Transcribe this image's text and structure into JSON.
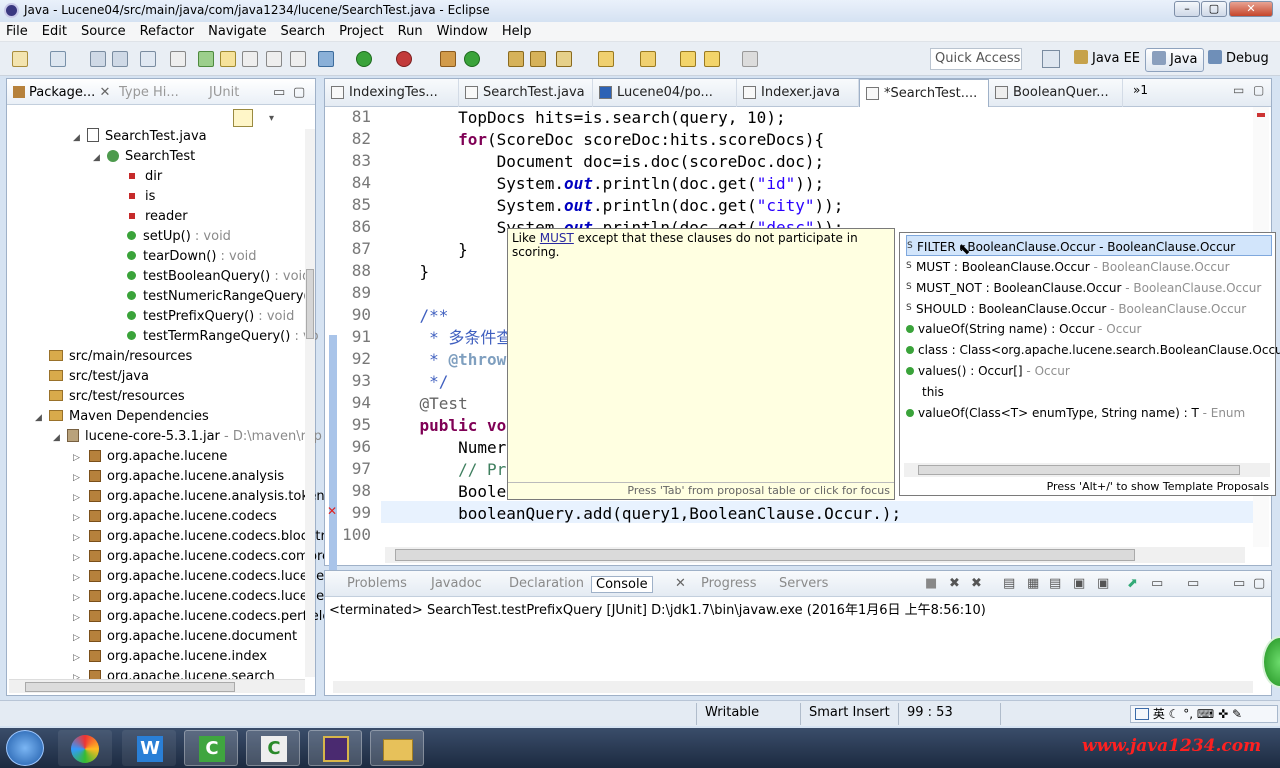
{
  "window": {
    "title": "Java - Lucene04/src/main/java/com/java1234/lucene/SearchTest.java - Eclipse",
    "min": "–",
    "max": "▢",
    "close": "✕"
  },
  "menu": [
    "File",
    "Edit",
    "Source",
    "Refactor",
    "Navigate",
    "Search",
    "Project",
    "Run",
    "Window",
    "Help"
  ],
  "quick_access": "Quick Access",
  "perspectives": [
    {
      "label": "Java EE",
      "active": false
    },
    {
      "label": "Java",
      "active": true
    },
    {
      "label": "Debug",
      "active": false
    }
  ],
  "left_tabs": [
    "Package...",
    "Type Hi...",
    "JUnit"
  ],
  "tree": [
    {
      "text": "SearchTest.java",
      "kind": "jfile"
    },
    {
      "text": "SearchTest",
      "kind": "class"
    },
    {
      "text": "dir",
      "kind": "field"
    },
    {
      "text": "is",
      "kind": "field"
    },
    {
      "text": "reader",
      "kind": "field"
    },
    {
      "text": "setUp()",
      "type": " : void",
      "kind": "method"
    },
    {
      "text": "tearDown()",
      "type": " : void",
      "kind": "method"
    },
    {
      "text": "testBooleanQuery()",
      "type": " : void",
      "kind": "method"
    },
    {
      "text": "testNumericRangeQuery()",
      "type": "",
      "kind": "method"
    },
    {
      "text": "testPrefixQuery()",
      "type": " : void",
      "kind": "method"
    },
    {
      "text": "testTermRangeQuery()",
      "type": " : vo",
      "kind": "method"
    },
    {
      "text": "src/main/resources",
      "kind": "folder"
    },
    {
      "text": "src/test/java",
      "kind": "folder"
    },
    {
      "text": "src/test/resources",
      "kind": "folder"
    },
    {
      "text": "Maven Dependencies",
      "kind": "folder"
    },
    {
      "text": "lucene-core-5.3.1.jar",
      "type": " - D:\\maven\\rep",
      "kind": "jar"
    },
    {
      "text": "org.apache.lucene",
      "kind": "pkg"
    },
    {
      "text": "org.apache.lucene.analysis",
      "kind": "pkg"
    },
    {
      "text": "org.apache.lucene.analysis.tokena",
      "kind": "pkg"
    },
    {
      "text": "org.apache.lucene.codecs",
      "kind": "pkg"
    },
    {
      "text": "org.apache.lucene.codecs.blocktr",
      "kind": "pkg"
    },
    {
      "text": "org.apache.lucene.codecs.compre",
      "kind": "pkg"
    },
    {
      "text": "org.apache.lucene.codecs.lucene5",
      "kind": "pkg"
    },
    {
      "text": "org.apache.lucene.codecs.lucene5",
      "kind": "pkg"
    },
    {
      "text": "org.apache.lucene.codecs.perfielc",
      "kind": "pkg"
    },
    {
      "text": "org.apache.lucene.document",
      "kind": "pkg"
    },
    {
      "text": "org.apache.lucene.index",
      "kind": "pkg"
    },
    {
      "text": "org.apache.lucene.search",
      "kind": "pkg"
    }
  ],
  "editor_tabs": [
    "IndexingTes...",
    "SearchTest.java",
    "Lucene04/po...",
    "Indexer.java",
    "*SearchTest....",
    "BooleanQuer..."
  ],
  "editor_more": "»1",
  "line_numbers": [
    "81",
    "82",
    "83",
    "84",
    "85",
    "86",
    "87",
    "88",
    "89",
    "90",
    "91",
    "92",
    "93",
    "94",
    "95",
    "96",
    "97",
    "98",
    "99",
    "100"
  ],
  "code": {
    "l81": "        TopDocs hits=is.search(query, 10);",
    "l82a": "        ",
    "l82kw": "for",
    "l82b": "(ScoreDoc scoreDoc:hits.scoreDocs){",
    "l83": "            Document doc=is.doc(scoreDoc.doc);",
    "l84a": "            System.",
    "l84out": "out",
    "l84b": ".println(doc.get(",
    "l84s": "\"id\"",
    "l84c": "));",
    "l85a": "            System.",
    "l85out": "out",
    "l85b": ".println(doc.get(",
    "l85s": "\"city\"",
    "l85c": "));",
    "l86a": "            System.",
    "l86out": "out",
    "l86b": ".println(doc.get(",
    "l86s": "\"desc\"",
    "l86c": "));",
    "l87": "        }",
    "l88": "    }",
    "l90": "    /**",
    "l91": "     * 多条件查",
    "l92a": "     * ",
    "l92b": "@throw",
    "l93": "     */",
    "l94": "    @Test",
    "l95a": "    ",
    "l95kw": "public vo",
    "l96": "        Numer",
    "l97": "        // Pr",
    "l98": "        Boole",
    "l99": "        booleanQuery.add(query1,BooleanClause.Occur.);"
  },
  "javadoc": {
    "pre": "Like ",
    "link": "MUST",
    "post": " except that these clauses do not participate in scoring.",
    "footer": "Press 'Tab' from proposal table or click for focus"
  },
  "proposals": [
    {
      "name": "FILTER : BooleanClause.Occur",
      "src": " - BooleanClause.Occur",
      "kind": "field",
      "selected": true
    },
    {
      "name": "MUST : BooleanClause.Occur",
      "src": " - BooleanClause.Occur",
      "kind": "field"
    },
    {
      "name": "MUST_NOT : BooleanClause.Occur",
      "src": " - BooleanClause.Occur",
      "kind": "field"
    },
    {
      "name": "SHOULD : BooleanClause.Occur",
      "src": " - BooleanClause.Occur",
      "kind": "field"
    },
    {
      "name": "valueOf(String name) : Occur",
      "src": " - Occur",
      "kind": "method"
    },
    {
      "name": "class : Class<org.apache.lucene.search.BooleanClause.Occur",
      "src": "",
      "kind": "method"
    },
    {
      "name": "values() : Occur[]",
      "src": " - Occur",
      "kind": "method"
    },
    {
      "name": "this",
      "src": "",
      "kind": "none"
    },
    {
      "name": "valueOf(Class<T> enumType, String name) : T",
      "src": " - Enum",
      "kind": "method"
    }
  ],
  "proposals_footer": "Press 'Alt+/' to show Template Proposals",
  "console_tabs": [
    {
      "label": "Problems",
      "active": false
    },
    {
      "label": "Javadoc",
      "active": false
    },
    {
      "label": "Declaration",
      "active": false
    },
    {
      "label": "Console",
      "active": true
    },
    {
      "label": "Progress",
      "active": false
    },
    {
      "label": "Servers",
      "active": false
    }
  ],
  "console_line": "<terminated> SearchTest.testPrefixQuery [JUnit] D:\\jdk1.7\\bin\\javaw.exe (2016年1月6日 上午8:56:10)",
  "status": {
    "writable": "Writable",
    "insert": "Smart Insert",
    "pos": "99 : 53"
  },
  "ime": "英",
  "watermark": "www.java1234.com"
}
